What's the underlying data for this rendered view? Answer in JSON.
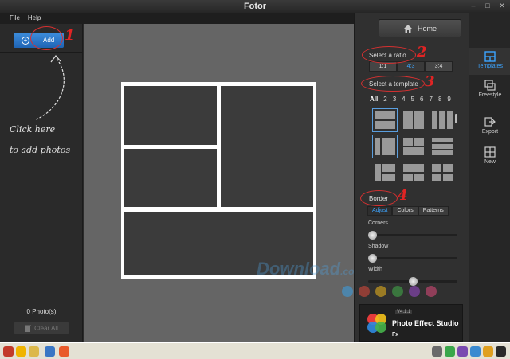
{
  "window": {
    "title": "Fotor"
  },
  "menu": [
    "File",
    "Help"
  ],
  "left_panel": {
    "add_label": "Add",
    "hint_line1": "Click here",
    "hint_line2": "to add photos",
    "photo_count": "0 Photo(s)",
    "clear_all": "Clear All"
  },
  "right_panel": {
    "home_label": "Home",
    "select_ratio": "Select a ratio",
    "ratios": [
      "1:1",
      "4:3",
      "3:4"
    ],
    "active_ratio": "4:3",
    "select_template": "Select a template",
    "template_filter": [
      "All",
      "2",
      "3",
      "4",
      "5",
      "6",
      "7",
      "8",
      "9"
    ],
    "border_title": "Border",
    "border_tabs": [
      "Adjust",
      "Colors",
      "Patterns"
    ],
    "sliders": [
      {
        "label": "Corners",
        "value": 0
      },
      {
        "label": "Shadow",
        "value": 0
      },
      {
        "label": "Width",
        "value": 0.5
      }
    ],
    "promo": {
      "version": "V4.1.1",
      "title": "Photo Effect Studio",
      "fx": "Fx"
    }
  },
  "sidebar": [
    {
      "label": "Templates",
      "icon": "templates-icon"
    },
    {
      "label": "Freestyle",
      "icon": "freestyle-icon"
    },
    {
      "label": "Export",
      "icon": "export-icon"
    },
    {
      "label": "New",
      "icon": "new-icon"
    }
  ],
  "annotations": [
    "1",
    "2",
    "3",
    "4"
  ],
  "watermark": {
    "main": "Download",
    "suffix": ".com.vn"
  },
  "colors": {
    "accent": "#3ca4ff",
    "annotation": "#d63030",
    "add_button": "#2b78cc"
  }
}
